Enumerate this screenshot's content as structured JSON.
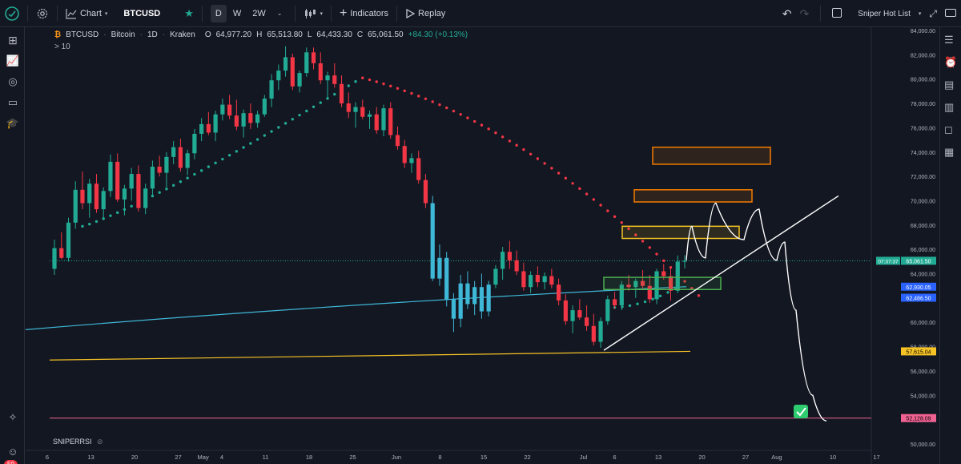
{
  "toolbar": {
    "chart_label": "Chart",
    "symbol": "BTCUSD",
    "intervals": [
      "D",
      "W",
      "2W"
    ],
    "active_interval": "D",
    "indicators_label": "Indicators",
    "replay_label": "Replay",
    "watchlist_label": "Sniper Hot List"
  },
  "legend": {
    "symbol": "BTCUSD",
    "name": "Bitcoin",
    "interval": "1D",
    "exchange": "Kraken",
    "open_k": "O",
    "open": "64,977.20",
    "high_k": "H",
    "high": "65,513.80",
    "low_k": "L",
    "low": "64,433.30",
    "close_k": "C",
    "close": "65,061.50",
    "change": "+84.30 (+0.13%)",
    "sub": "> 10"
  },
  "indicator_label": "SNIPERRSI",
  "notification_count": "50",
  "price_labels": {
    "countdown": "07:37:37",
    "last": "65,061.50",
    "blue1": "62,930.05",
    "blue2": "62,486.50",
    "yellow": "57,615.04",
    "pink": "52,128.09"
  },
  "colors": {
    "up": "#22ab94",
    "down": "#f23645",
    "ma_blue": "#3fb8d8",
    "ma_yellow": "#f7c325",
    "pink_line": "#f06292",
    "sar_up": "#22ab94",
    "sar_down": "#f23645",
    "orange_box": "#f57c00",
    "yellow_box": "#f7c325",
    "green_box": "#4caf50"
  },
  "chart_data": {
    "type": "candlestick",
    "y_axis_ticks": [
      "84,000.00",
      "82,000.00",
      "80,000.00",
      "78,000.00",
      "76,000.00",
      "74,000.00",
      "72,000.00",
      "70,000.00",
      "68,000.00",
      "66,000.00",
      "64,000.00",
      "62,000.00",
      "60,000.00",
      "58,000.00",
      "56,000.00",
      "54,000.00",
      "52,000.00",
      "50,000.00"
    ],
    "y_axis_values": [
      84000,
      82000,
      80000,
      78000,
      76000,
      74000,
      72000,
      70000,
      68000,
      66000,
      64000,
      62000,
      60000,
      58000,
      56000,
      54000,
      52000,
      50000
    ],
    "ylim": [
      50000,
      84000
    ],
    "x_axis_ticks": [
      "6",
      "13",
      "20",
      "27",
      "May",
      "4",
      "11",
      "18",
      "25",
      "Jun",
      "8",
      "15",
      "22",
      "Jul",
      "6",
      "13",
      "20",
      "27",
      "Aug",
      "10",
      "17"
    ],
    "x_axis_days": [
      6,
      13,
      20,
      27,
      31,
      34,
      41,
      48,
      55,
      62,
      69,
      76,
      83,
      92,
      97,
      104,
      111,
      118,
      123,
      132,
      139
    ],
    "candles": [
      [
        64400,
        66800,
        63900,
        66100
      ],
      [
        66100,
        67400,
        65200,
        65300
      ],
      [
        65300,
        68600,
        65000,
        68200
      ],
      [
        68200,
        71600,
        67700,
        70900
      ],
      [
        70900,
        72400,
        69300,
        69800
      ],
      [
        69800,
        71800,
        68600,
        71400
      ],
      [
        71400,
        72200,
        69000,
        69300
      ],
      [
        69300,
        71100,
        68600,
        70800
      ],
      [
        70800,
        73800,
        70300,
        73200
      ],
      [
        73200,
        73900,
        69900,
        70100
      ],
      [
        70100,
        71300,
        68800,
        71000
      ],
      [
        71000,
        72700,
        70000,
        72200
      ],
      [
        72200,
        72900,
        69100,
        69400
      ],
      [
        69400,
        71400,
        68900,
        71000
      ],
      [
        71000,
        73300,
        70400,
        72800
      ],
      [
        72800,
        73700,
        72000,
        72300
      ],
      [
        72300,
        74000,
        71100,
        73600
      ],
      [
        73600,
        74900,
        73000,
        74400
      ],
      [
        74400,
        75100,
        72400,
        72700
      ],
      [
        72700,
        74200,
        72100,
        73900
      ],
      [
        73900,
        75900,
        73400,
        75500
      ],
      [
        75500,
        76800,
        74900,
        76300
      ],
      [
        76300,
        77300,
        75400,
        75600
      ],
      [
        75600,
        77400,
        74900,
        77100
      ],
      [
        77100,
        78400,
        76600,
        77900
      ],
      [
        77900,
        78700,
        76700,
        77000
      ],
      [
        77000,
        78300,
        75800,
        76100
      ],
      [
        76100,
        77500,
        75200,
        77200
      ],
      [
        77200,
        78000,
        75900,
        76400
      ],
      [
        76400,
        77400,
        76000,
        77100
      ],
      [
        77100,
        78700,
        76900,
        78400
      ],
      [
        78400,
        80400,
        77700,
        79900
      ],
      [
        79900,
        81200,
        79100,
        80700
      ],
      [
        80700,
        82700,
        80200,
        81800
      ],
      [
        81800,
        82100,
        79100,
        79400
      ],
      [
        79400,
        80700,
        78900,
        80500
      ],
      [
        80500,
        82600,
        80200,
        82200
      ],
      [
        82200,
        82600,
        80800,
        81300
      ],
      [
        81300,
        82200,
        79600,
        79900
      ],
      [
        79900,
        80600,
        78300,
        80300
      ],
      [
        80300,
        81300,
        79300,
        79600
      ],
      [
        79600,
        80300,
        77700,
        78000
      ],
      [
        78000,
        78900,
        76800,
        77300
      ],
      [
        77300,
        78100,
        76000,
        77700
      ],
      [
        77700,
        78300,
        76700,
        76900
      ],
      [
        76900,
        77400,
        75900,
        77100
      ],
      [
        77100,
        77700,
        75500,
        75800
      ],
      [
        75800,
        77900,
        75300,
        77600
      ],
      [
        77600,
        78100,
        75100,
        75400
      ],
      [
        75400,
        76100,
        74200,
        74500
      ],
      [
        74500,
        75000,
        72700,
        73100
      ],
      [
        73100,
        73900,
        72300,
        73500
      ],
      [
        73500,
        74100,
        71400,
        71700
      ],
      [
        71700,
        72200,
        69400,
        69800
      ],
      [
        69800,
        70400,
        63400,
        63600
      ],
      [
        63600,
        66400,
        63000,
        65300
      ],
      [
        65300,
        65800,
        61300,
        61900
      ],
      [
        61900,
        62400,
        59200,
        60300
      ],
      [
        60300,
        63900,
        59600,
        63200
      ],
      [
        63200,
        64200,
        61100,
        61500
      ],
      [
        61500,
        63400,
        60600,
        62900
      ],
      [
        62900,
        64000,
        60300,
        60900
      ],
      [
        60900,
        63400,
        60500,
        63100
      ],
      [
        63100,
        64700,
        62800,
        64400
      ],
      [
        64400,
        66200,
        63500,
        65800
      ],
      [
        65800,
        66700,
        64400,
        65100
      ],
      [
        65100,
        65900,
        63900,
        64200
      ],
      [
        64200,
        64900,
        62600,
        62900
      ],
      [
        62900,
        64200,
        62400,
        63900
      ],
      [
        63900,
        64600,
        62900,
        63300
      ],
      [
        63300,
        64100,
        62700,
        63800
      ],
      [
        63800,
        64400,
        62800,
        63100
      ],
      [
        63100,
        63600,
        61400,
        61800
      ],
      [
        61800,
        62300,
        59800,
        60100
      ],
      [
        60100,
        61400,
        59100,
        61000
      ],
      [
        61000,
        61900,
        60200,
        60400
      ],
      [
        60400,
        61400,
        59300,
        59700
      ],
      [
        59700,
        60700,
        58100,
        58400
      ],
      [
        58400,
        60400,
        57900,
        60100
      ],
      [
        60100,
        62200,
        59800,
        61900
      ],
      [
        61900,
        62500,
        61100,
        61400
      ],
      [
        61400,
        63400,
        61000,
        63100
      ],
      [
        63100,
        63900,
        62600,
        62900
      ],
      [
        62900,
        63600,
        62000,
        63400
      ],
      [
        63400,
        64300,
        62700,
        63000
      ],
      [
        63000,
        63900,
        61600,
        61900
      ],
      [
        61900,
        64400,
        61500,
        64200
      ],
      [
        64200,
        64800,
        63500,
        63800
      ],
      [
        63800,
        64400,
        61800,
        62600
      ],
      [
        62600,
        65500,
        62400,
        65000
      ],
      [
        64977,
        65514,
        64433,
        65062
      ]
    ],
    "ma_blue": {
      "start": 59400,
      "end": 62930
    },
    "ma_yellow": {
      "start": 56900,
      "end": 57615
    },
    "pink_level": 52128,
    "sar_up_1": {
      "from": 67900,
      "to": 79800
    },
    "sar_down": {
      "peak": 80100,
      "end": 62200
    },
    "sar_up_2": {
      "from": 61200,
      "to": 62800
    },
    "boxes": [
      {
        "color": "orange",
        "y1": 73000,
        "y2": 74400
      },
      {
        "color": "orange",
        "y1": 69900,
        "y2": 70900
      },
      {
        "color": "yellow",
        "y1": 66900,
        "y2": 67900
      },
      {
        "color": "green",
        "y1": 62700,
        "y2": 63700
      }
    ],
    "projection": [
      65100,
      67900,
      65300,
      69800,
      66800,
      69300,
      65100,
      66600,
      61000,
      54000,
      51900
    ],
    "trendline": {
      "from": 57700,
      "to": 70400
    }
  }
}
